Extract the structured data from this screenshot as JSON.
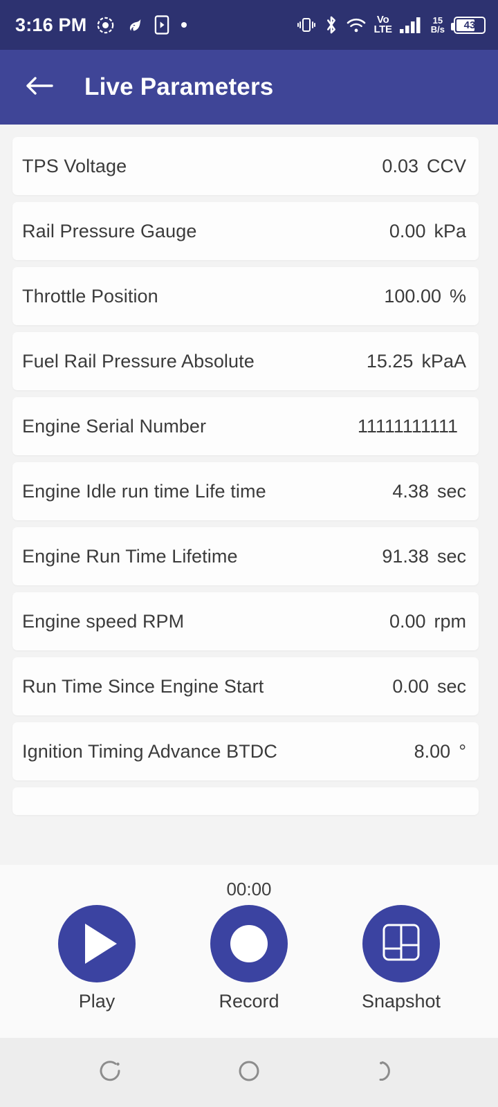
{
  "status_bar": {
    "time": "3:16 PM",
    "left_icons": [
      "camera-privacy-icon",
      "bird-app-icon",
      "cast-screen-icon",
      "dot-icon"
    ],
    "right_icons": [
      "vibrate-icon",
      "bluetooth-icon",
      "wifi-icon"
    ],
    "network_type_top": "Vo",
    "network_type_bottom": "LTE",
    "data_rate_value": "15",
    "data_rate_unit": "B/s",
    "battery_percent": "43",
    "bar_color": "#2d3270"
  },
  "app_bar": {
    "back_icon": "arrow-left-icon",
    "title": "Live Parameters",
    "color": "#3f4597"
  },
  "parameters": [
    {
      "label": "TPS Voltage",
      "value": "0.03",
      "unit": "CCV"
    },
    {
      "label": "Rail Pressure Gauge",
      "value": "0.00",
      "unit": "kPa"
    },
    {
      "label": "Throttle Position",
      "value": "100.00",
      "unit": "%"
    },
    {
      "label": "Fuel Rail Pressure Absolute",
      "value": "15.25",
      "unit": "kPaA"
    },
    {
      "label": "Engine Serial Number",
      "value": "11111111111",
      "unit": ""
    },
    {
      "label": "Engine Idle run time  Life time",
      "value": "4.38",
      "unit": "sec"
    },
    {
      "label": "Engine Run Time Lifetime",
      "value": "91.38",
      "unit": "sec"
    },
    {
      "label": "Engine speed RPM",
      "value": "0.00",
      "unit": "rpm"
    },
    {
      "label": "Run Time Since Engine Start",
      "value": "0.00",
      "unit": "sec"
    },
    {
      "label": "Ignition Timing Advance BTDC",
      "value": "8.00",
      "unit": "°"
    }
  ],
  "controls": {
    "timer": "00:00",
    "accent_color": "#3b43a1",
    "buttons": [
      {
        "label": "Play",
        "icon": "play-icon"
      },
      {
        "label": "Record",
        "icon": "record-icon"
      },
      {
        "label": "Snapshot",
        "icon": "dashboard-grid-icon"
      }
    ]
  },
  "nav_bar": {
    "buttons": [
      {
        "icon": "recents-icon"
      },
      {
        "icon": "home-circle-icon"
      },
      {
        "icon": "back-icon"
      }
    ]
  }
}
